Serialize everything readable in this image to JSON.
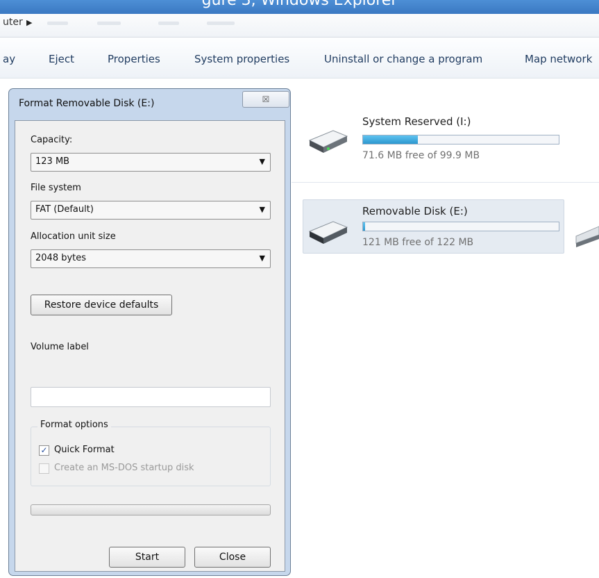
{
  "window": {
    "caption": "gure 3, Windows Explorer"
  },
  "address": {
    "crumb": "uter",
    "arrow": "▶"
  },
  "commands": [
    "ay",
    "Eject",
    "Properties",
    "System properties",
    "Uninstall or change a program",
    "Map network"
  ],
  "drives": [
    {
      "name": "System Reserved (I:)",
      "free_text": "71.6 MB free of 99.9 MB",
      "used_fraction": 0.28
    },
    {
      "name": "Removable Disk (E:)",
      "free_text": "121 MB free of 122 MB",
      "used_fraction": 0.01
    }
  ],
  "dialog": {
    "title": "Format Removable Disk (E:)",
    "close_glyph": "☒",
    "capacity": {
      "label": "Capacity:",
      "value": "123 MB"
    },
    "file_system": {
      "label": "File system",
      "value": "FAT (Default)"
    },
    "allocation": {
      "label": "Allocation unit size",
      "value": "2048 bytes"
    },
    "restore_button": "Restore device defaults",
    "volume": {
      "label": "Volume label",
      "value": ""
    },
    "format_options": {
      "legend": "Format options",
      "quick_format": {
        "label": "Quick Format",
        "checked": true,
        "check_glyph": "✓"
      },
      "msdos": {
        "label": "Create an MS-DOS startup disk",
        "checked": false,
        "enabled": false
      }
    },
    "progress": 0,
    "start_button": "Start",
    "close_button": "Close",
    "dropdown_glyph": "▼"
  },
  "colors": {
    "titlebar": "#3a78c2",
    "dialog_frame": "#c6d7ec",
    "drive_fill": "#2c97cf",
    "command_text": "#1e3a5f",
    "disabled_text": "#9a9a9a"
  }
}
